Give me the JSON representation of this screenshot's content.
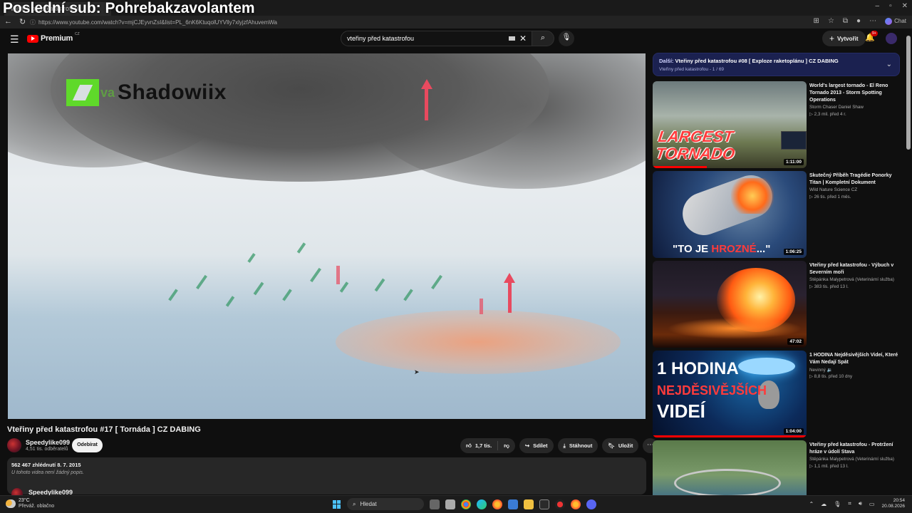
{
  "overlay_title": "Poslední sub: Pohrebakzavolantem",
  "browser": {
    "tab_title": "Vteřiny před katastrofou",
    "url": "https://www.youtube.com/watch?v=mjCJEyvnZsI&list=PL_6nK6KtuqolUYVlly7xlyjzfAhuvemWa",
    "chat_label": "Chat"
  },
  "youtube": {
    "logo_text": "Premium",
    "logo_country": "CZ",
    "search_value": "vteřiny před katastrofou",
    "create_label": "Vytvořit",
    "notif_count": "9+"
  },
  "player": {
    "kva_text": "va",
    "brand_text": "Shadowiix"
  },
  "video": {
    "title": "Vteřiny před katastrofou #17 [ Tornáda ] CZ DABING",
    "channel": "Speedylike099",
    "subscribers": "4,51 tis. odběratelů",
    "subscribe_label": "Odebírat",
    "likes": "1,7 tis.",
    "share_label": "Sdílet",
    "download_label": "Stáhnout",
    "save_label": "Uložit",
    "views_date": "562 467 zhlédnutí  8. 7. 2015",
    "description": "U tohoto videa není žádný popis.",
    "comment_author": "Speedylike099"
  },
  "playlist": {
    "next_prefix": "Další:",
    "next_title": "Vteřiny před katastrofou #08 [ Exploze raketoplánu ] CZ DABING",
    "sub": "Vteřiny před katastrofou - 1 / 69"
  },
  "recommendations": [
    {
      "title": "World's largest tornado - El Reno Tornado 2013 - Storm Spotting Operations",
      "channel": "Storm Chaser Daniel Shaw",
      "meta": "▷ 2,3 mil.  před 4 r.",
      "duration": "1:11:00",
      "thumb_text": [
        "LARGEST",
        "TORNADO"
      ],
      "progress": 0.35
    },
    {
      "title": "Skutečný Příběh Tragédie Ponorky Titan | Kompletní Dokument",
      "channel": "Wild Nature Science CZ",
      "meta": "▷ 26 tis.  před 1 měs.",
      "duration": "1:06:25",
      "thumb_text": [
        "\"TO JE ",
        "HROZNÉ",
        "...\""
      ]
    },
    {
      "title": "Vteřiny před katastrofou - Výbuch v Severním moři",
      "channel": "Štěpánka Malypetrová (Veterinární služba)",
      "meta": "▷ 383 tis.  před 13 l.",
      "duration": "47:02"
    },
    {
      "title": "1 HODINA Nejděsivějších Videí, Které Vám Nedají Spát",
      "channel": "Nevinný 🔉",
      "meta": "▷ 8,8 tis.  před 10 dny",
      "duration": "1:04:00",
      "thumb_text": [
        "1 HODINA",
        "NEJDĚSIVĚJŠÍCH",
        "VIDEÍ"
      ],
      "progress": 1.0
    },
    {
      "title": "Vteřiny před katastrofou - Protržení hráze v údolí Stava",
      "channel": "Štěpánka Malypetrová (Veterinární služba)",
      "meta": "▷ 1,1 mil.  před 13 l."
    }
  ],
  "taskbar": {
    "temperature": "23°C",
    "condition": "Převáž. oblačno",
    "search_label": "Hledat",
    "time": "20:54",
    "date": "20.08.2026"
  }
}
